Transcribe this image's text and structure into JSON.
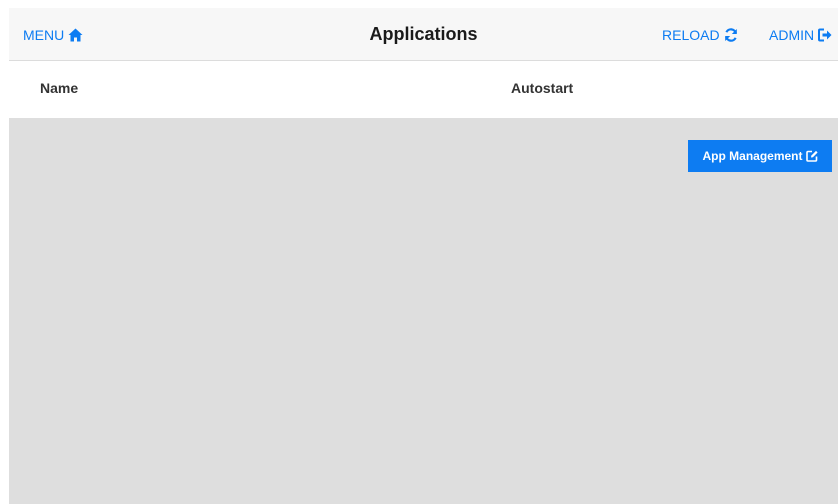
{
  "header": {
    "menu_label": "MENU",
    "title": "Applications",
    "reload_label": "RELOAD",
    "admin_label": "ADMIN"
  },
  "table": {
    "columns": [
      "Name",
      "Autostart"
    ]
  },
  "actions": {
    "app_management_label": "App Management"
  },
  "colors": {
    "accent": "#0d7cf2",
    "topbar_bg": "#f7f7f7",
    "content_bg": "#dedede"
  },
  "icons": {
    "menu": "home-icon",
    "reload": "refresh-icon",
    "admin": "sign-out-icon",
    "app_management": "edit-icon"
  }
}
